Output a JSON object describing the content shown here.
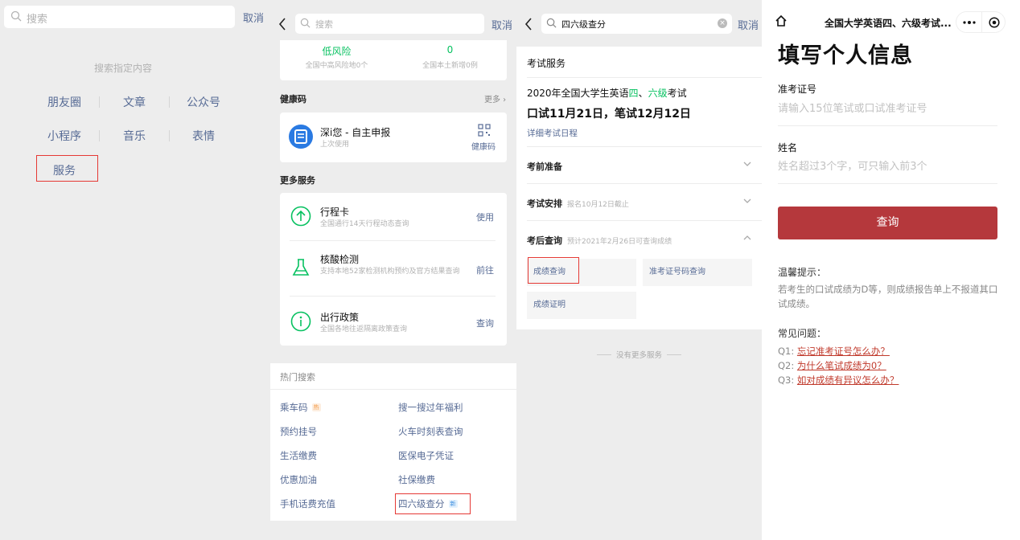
{
  "panel1": {
    "search_placeholder": "搜索",
    "cancel": "取消",
    "hint": "搜索指定内容",
    "categories_row1": [
      "朋友圈",
      "文章",
      "公众号"
    ],
    "categories_row2": [
      "小程序",
      "音乐",
      "表情"
    ],
    "service": "服务"
  },
  "panel2": {
    "search_placeholder": "搜索",
    "cancel": "取消",
    "risk": {
      "left_value": "低风险",
      "left_sub": "全国中高风险地0个",
      "right_value": "0",
      "right_sub": "全国本土新增0例"
    },
    "health_title": "健康码",
    "more": "更多",
    "health_app": {
      "title": "深i您 - 自主申报",
      "sub": "上次使用",
      "action": "健康码"
    },
    "more_services_title": "更多服务",
    "services": [
      {
        "title": "行程卡",
        "sub": "全国通行14天行程动态查询",
        "action": "使用"
      },
      {
        "title": "核酸检测",
        "sub": "支持本地52家检测机构预约及官方结果查询",
        "action": "前往"
      },
      {
        "title": "出行政策",
        "sub": "全国各地往返隔离政策查询",
        "action": "查询"
      }
    ],
    "hot_title": "热门搜索",
    "hot_left": [
      "乘车码",
      "预约挂号",
      "生活缴费",
      "优惠加油",
      "手机话费充值"
    ],
    "hot_right": [
      "搜一搜过年福利",
      "火车时刻表查询",
      "医保电子凭证",
      "社保缴费",
      "四六级查分"
    ],
    "hot_tag": "热",
    "new_tag": "新"
  },
  "panel3": {
    "search_value": "四六级查分",
    "cancel": "取消",
    "section_title": "考试服务",
    "exam_title_pre": "2020年全国大学生英语",
    "exam_four": "四",
    "exam_sep": "、",
    "exam_six": "六级",
    "exam_title_post": "考试",
    "exam_dates": "口试11月21日，笔试12月12日",
    "schedule_link": "详细考试日程",
    "rows": [
      {
        "title": "考前准备",
        "sub": ""
      },
      {
        "title": "考试安排",
        "sub": "报名10月12日截止"
      },
      {
        "title": "考后查询",
        "sub": "预计2021年2月26日可查询成绩"
      }
    ],
    "buttons": [
      "成绩查询",
      "准考证号码查询",
      "成绩证明"
    ],
    "no_more": "没有更多服务"
  },
  "panel4": {
    "title": "全国大学英语四、六级考试...",
    "heading": "填写个人信息",
    "id_label": "准考证号",
    "id_placeholder": "请输入15位笔试或口试准考证号",
    "name_label": "姓名",
    "name_placeholder": "姓名超过3个字，可只输入前3个",
    "submit": "查询",
    "tip_title": "温馨提示：",
    "tip_text": "若考生的口试成绩为D等，则成绩报告单上不报道其口试成绩。",
    "faq_title": "常见问题：",
    "faq": [
      {
        "q": "Q1:",
        "text": "忘记准考证号怎么办？"
      },
      {
        "q": "Q2:",
        "text": "为什么笔试成绩为0？"
      },
      {
        "q": "Q3:",
        "text": "如对成绩有异议怎么办？"
      }
    ]
  },
  "colors": {
    "link": "#576b95",
    "green": "#07c160",
    "submit": "#b5383c",
    "highlight": "#e53935"
  }
}
